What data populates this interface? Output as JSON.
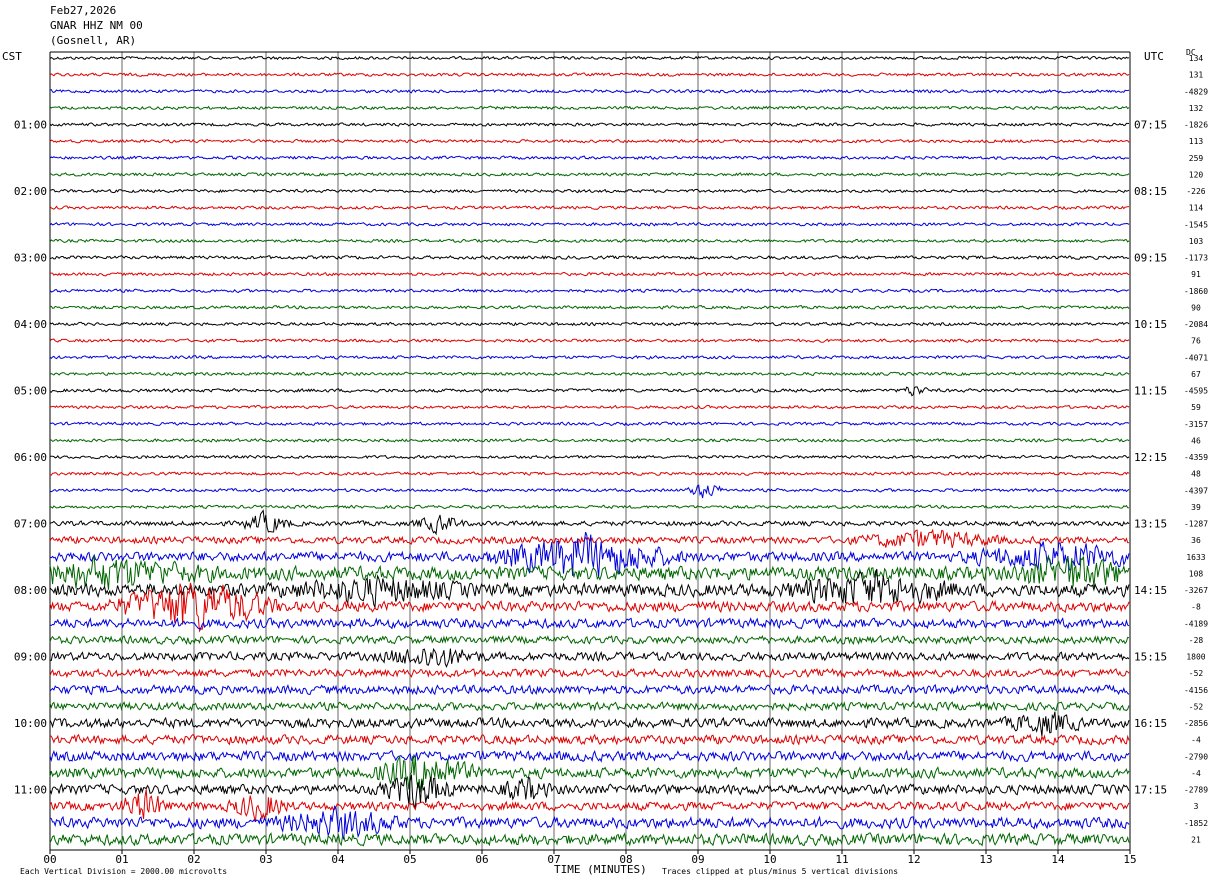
{
  "header": {
    "date": "Feb27,2026",
    "station": "GNAR HHZ NM 00",
    "location": "(Gosnell, AR)"
  },
  "left_axis_label": "CST",
  "right_axis_label": "UTC",
  "dc_label": "DC",
  "footer": {
    "scale_note": "Each Vertical Division = 2000.00 microvolts",
    "xlabel": "TIME (MINUTES)",
    "clip_note": "Traces clipped at plus/minus 5 vertical divisions"
  },
  "colors": {
    "trace_cycle": [
      "#000000",
      "#dd0000",
      "#0000dd",
      "#006600"
    ],
    "grid": "#000000"
  },
  "chart_data": {
    "type": "line",
    "title": "GNAR HHZ NM 00 (Gosnell, AR) Feb27,2026",
    "xlabel": "TIME (MINUTES)",
    "xlim": [
      0,
      15
    ],
    "x_ticks": [
      "00",
      "01",
      "02",
      "03",
      "04",
      "05",
      "06",
      "07",
      "08",
      "09",
      "10",
      "11",
      "12",
      "13",
      "14",
      "15"
    ],
    "trace_count": 48,
    "minutes_per_trace": 15,
    "cst_labels": [
      "01:00",
      "02:00",
      "03:00",
      "04:00",
      "05:00",
      "06:00",
      "07:00",
      "08:00",
      "09:00",
      "10:00",
      "11:00"
    ],
    "utc_labels": [
      "07:15",
      "08:15",
      "09:15",
      "10:15",
      "11:15",
      "12:15",
      "13:15",
      "14:15",
      "15:15",
      "16:15",
      "17:15"
    ],
    "hour_label_trace_index": [
      4,
      8,
      12,
      16,
      20,
      24,
      28,
      32,
      36,
      40,
      44
    ],
    "dc_offsets": [
      "134",
      "131",
      "-4829",
      "132",
      "-1826",
      "113",
      "259",
      "120",
      "-226",
      "114",
      "-1545",
      "103",
      "-1173",
      "91",
      "-1860",
      "90",
      "-2084",
      "76",
      "-4071",
      "67",
      "-4595",
      "59",
      "-3157",
      "46",
      "-4359",
      "48",
      "-4397",
      "39",
      "-1287",
      "36",
      "1633",
      "108",
      "-3267",
      "-8",
      "-4189",
      "-28",
      "1800",
      "-52",
      "-4156",
      "-52",
      "-2856",
      "-4",
      "-2790",
      "-4",
      "-2789",
      "3",
      "-1852",
      "21"
    ],
    "trace_activity": [
      1,
      1,
      1,
      1,
      1,
      1,
      1,
      1,
      1,
      1,
      1,
      1,
      1.1,
      1,
      1,
      1,
      1,
      1,
      1,
      1,
      1.1,
      1,
      1,
      1,
      1,
      1,
      1,
      1,
      1.6,
      2.3,
      3.2,
      4.5,
      4.2,
      3.4,
      3.1,
      2.5,
      2.8,
      2.6,
      2.9,
      2.6,
      3.1,
      3.0,
      3.3,
      3.4,
      3.2,
      2.8,
      3.6,
      3.7
    ],
    "events": [
      {
        "trace": 20,
        "minute": 12.0,
        "amplitude": 3,
        "width_min": 0.2
      },
      {
        "trace": 26,
        "minute": 9.1,
        "amplitude": 4,
        "width_min": 0.3
      },
      {
        "trace": 28,
        "minute": 3.0,
        "amplitude": 5,
        "width_min": 0.4
      },
      {
        "trace": 28,
        "minute": 5.4,
        "amplitude": 4,
        "width_min": 0.4
      },
      {
        "trace": 29,
        "minute": 12.2,
        "amplitude": 4,
        "width_min": 1.2
      },
      {
        "trace": 30,
        "minute": 7.4,
        "amplitude": 10,
        "width_min": 1.5
      },
      {
        "trace": 30,
        "minute": 14.0,
        "amplitude": 6,
        "width_min": 1.5
      },
      {
        "trace": 31,
        "minute": 0.8,
        "amplitude": 6,
        "width_min": 1.6
      },
      {
        "trace": 31,
        "minute": 14.2,
        "amplitude": 7,
        "width_min": 1.0
      },
      {
        "trace": 32,
        "minute": 11.4,
        "amplitude": 7,
        "width_min": 1.4
      },
      {
        "trace": 32,
        "minute": 4.5,
        "amplitude": 5,
        "width_min": 1.5
      },
      {
        "trace": 33,
        "minute": 2.0,
        "amplitude": 12,
        "width_min": 1.3
      },
      {
        "trace": 36,
        "minute": 5.3,
        "amplitude": 5,
        "width_min": 0.8
      },
      {
        "trace": 40,
        "minute": 13.8,
        "amplitude": 5,
        "width_min": 0.6
      },
      {
        "trace": 43,
        "minute": 5.2,
        "amplitude": 9,
        "width_min": 0.8
      },
      {
        "trace": 44,
        "minute": 5.1,
        "amplitude": 8,
        "width_min": 0.6
      },
      {
        "trace": 44,
        "minute": 6.6,
        "amplitude": 5,
        "width_min": 0.4
      },
      {
        "trace": 45,
        "minute": 1.3,
        "amplitude": 7,
        "width_min": 0.4
      },
      {
        "trace": 45,
        "minute": 2.9,
        "amplitude": 6,
        "width_min": 0.5
      },
      {
        "trace": 46,
        "minute": 4.0,
        "amplitude": 6,
        "width_min": 1.0
      }
    ]
  }
}
